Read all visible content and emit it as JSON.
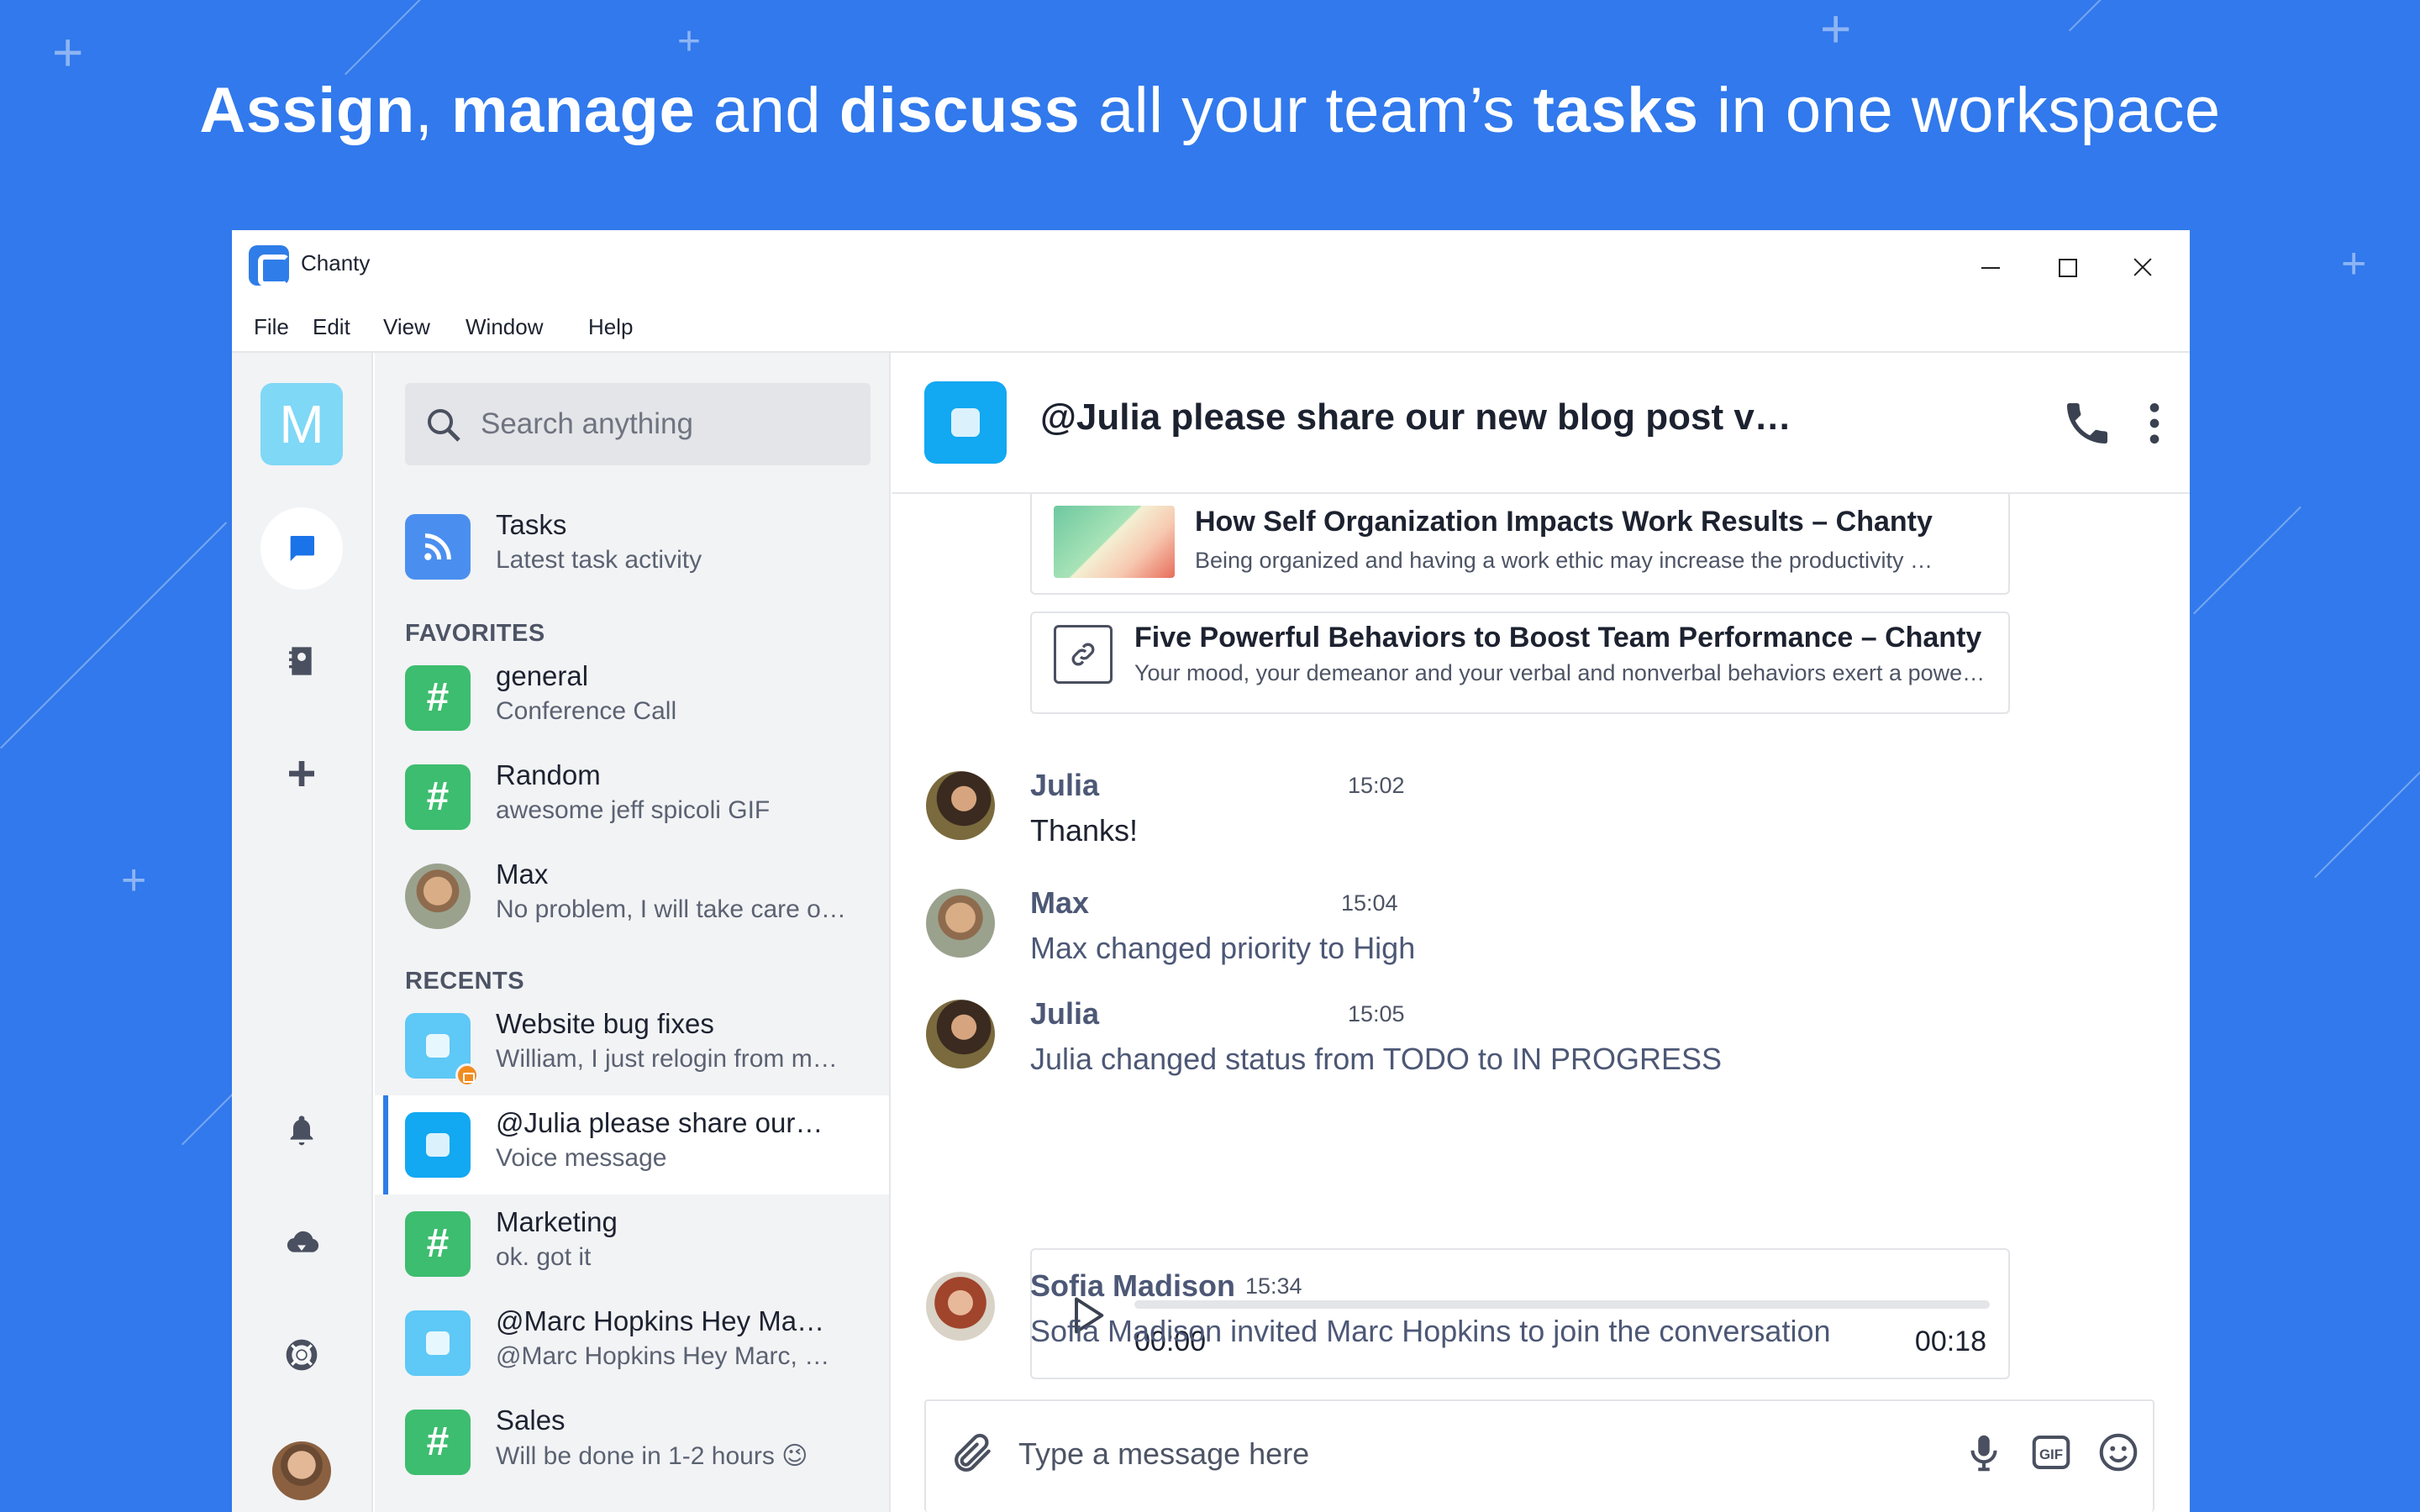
{
  "headline": {
    "w1": "Assign",
    "s1": ", ",
    "w2": "manage",
    "s2": " and ",
    "w3": "discuss",
    "s3": " all your team’s ",
    "w4": "tasks",
    "s4": " in one workspace"
  },
  "window": {
    "title": "Chanty",
    "menu": [
      "File",
      "Edit",
      "View",
      "Window",
      "Help"
    ]
  },
  "rail": {
    "workspace_initial": "M",
    "icons": [
      "chat-icon",
      "contacts-icon",
      "plus-icon",
      "bell-icon",
      "cloud-download-icon",
      "lifebuoy-icon"
    ]
  },
  "search": {
    "placeholder": "Search anything"
  },
  "tasks": {
    "title": "Tasks",
    "subtitle": "Latest task activity"
  },
  "favorites": {
    "label": "FAVORITES",
    "items": [
      {
        "title": "general",
        "subtitle": "Conference Call"
      },
      {
        "title": "Random",
        "subtitle": "awesome jeff spicoli GIF"
      },
      {
        "title": "Max",
        "subtitle": "No problem, I will take care o…"
      }
    ]
  },
  "recents": {
    "label": "RECENTS",
    "items": [
      {
        "title": "Website bug fixes",
        "subtitle": "William, I just relogin from m…"
      },
      {
        "title": "@Julia please share our…",
        "subtitle": "Voice message"
      },
      {
        "title": "Marketing",
        "subtitle": "ok. got it"
      },
      {
        "title": "@Marc Hopkins Hey Ma…",
        "subtitle": "@Marc Hopkins Hey Marc, …"
      },
      {
        "title": "Sales",
        "subtitle": "Will be done in 1-2 hours 😉"
      }
    ]
  },
  "chat": {
    "title": "@Julia please share our new blog post vi…",
    "links": [
      {
        "title": "How Self Organization Impacts Work Results – Chanty",
        "desc": "Being organized and having a work ethic may increase the productivity …"
      },
      {
        "title": "Five Powerful Behaviors to Boost Team Performance – Chanty",
        "desc": "Your mood, your demeanor and your verbal and nonverbal behaviors exert a powerf…"
      }
    ],
    "messages": [
      {
        "author": "Julia",
        "time": "15:02",
        "text": "Thanks!"
      },
      {
        "author": "Max",
        "time": "15:04",
        "text": "Max changed priority to High"
      },
      {
        "author": "Julia",
        "time": "15:05",
        "text": "Julia changed status from TODO to IN PROGRESS"
      },
      {
        "author": "Sofia Madison",
        "time": "15:34",
        "text": "Sofia Madison invited Marc Hopkins to join the conversation"
      }
    ],
    "voice": {
      "current": "00:00",
      "duration": "00:18",
      "progress": 0
    },
    "composer_placeholder": "Type a message here"
  }
}
